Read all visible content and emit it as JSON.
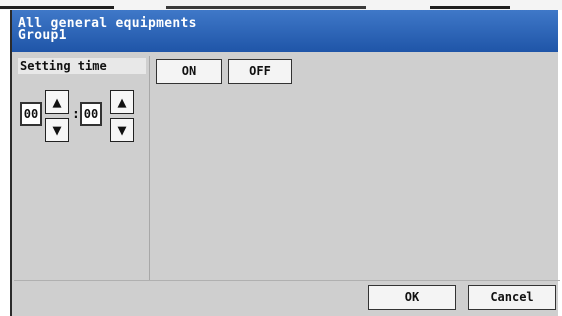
{
  "window": {
    "title_line1": "All general equipments",
    "title_line2": "Group1"
  },
  "setting": {
    "label": "Setting time",
    "hour": "00",
    "minute": "00",
    "separator": ":"
  },
  "buttons": {
    "on": "ON",
    "off": "OFF",
    "ok": "OK",
    "cancel": "Cancel"
  },
  "icons": {
    "up": "▲",
    "down": "▼"
  }
}
